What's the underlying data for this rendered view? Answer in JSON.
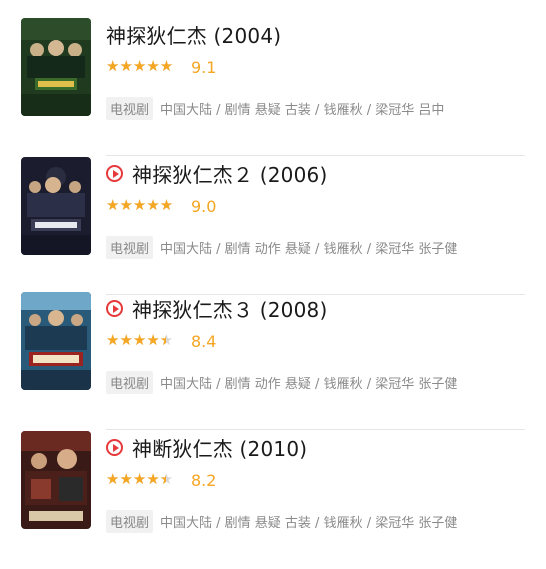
{
  "colors": {
    "star": "#f5a623",
    "play": "#e6393b",
    "star_empty": "#d9d9d9"
  },
  "items": [
    {
      "title": "神探狄仁杰 (2004)",
      "has_play_icon": false,
      "rating_fraction": 0.9,
      "score": "9.1",
      "type": "电视剧",
      "meta": "中国大陆 / 剧情 悬疑 古装 / 钱雁秋 / 梁冠华 吕中",
      "poster_icon": "poster-image"
    },
    {
      "title": "神探狄仁杰２ (2006)",
      "has_play_icon": true,
      "rating_fraction": 0.9,
      "score": "9.0",
      "type": "电视剧",
      "meta": "中国大陆 / 剧情 动作 悬疑 / 钱雁秋 / 梁冠华 张子健",
      "poster_icon": "poster-image"
    },
    {
      "title": "神探狄仁杰３ (2008)",
      "has_play_icon": true,
      "rating_fraction": 0.8,
      "score": "8.4",
      "type": "电视剧",
      "meta": "中国大陆 / 剧情 动作 悬疑 / 钱雁秋 / 梁冠华 张子健",
      "poster_icon": "poster-image"
    },
    {
      "title": "神断狄仁杰 (2010)",
      "has_play_icon": true,
      "rating_fraction": 0.8,
      "score": "8.2",
      "type": "电视剧",
      "meta": "中国大陆 / 剧情 悬疑 古装 / 钱雁秋 / 梁冠华 张子健",
      "poster_icon": "poster-image"
    }
  ]
}
